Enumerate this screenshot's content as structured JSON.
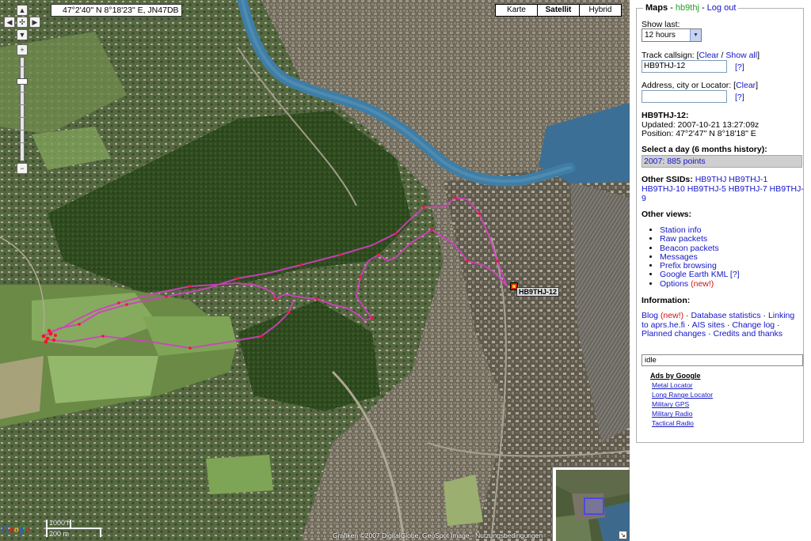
{
  "map": {
    "coordinates": "47°2'40\" N 8°18'23\" E, JN47DB",
    "map_types": [
      {
        "label": "Karte",
        "active": false
      },
      {
        "label": "Satellit",
        "active": true
      },
      {
        "label": "Hybrid",
        "active": false
      }
    ],
    "zoom_in": "+",
    "zoom_out": "−",
    "station_label": "HB9THJ-12",
    "track_color": "#d040c0",
    "beacon_color": "#ff1030",
    "scale": {
      "top": "1000 ft",
      "bottom": "200 m"
    },
    "copyright": "Grafiken ©2007 DigitalGlobe, GeoSpot Image - Nutzungsbedingungen",
    "google_logo": [
      "G",
      "o",
      "o",
      "g",
      "l",
      "e"
    ]
  },
  "sidebar": {
    "legend_title": "Maps",
    "legend_sep1": " - ",
    "user": "hb9thj",
    "legend_sep2": " - ",
    "logout": "Log out",
    "show_last_label": "Show last:",
    "show_last_value": "12 hours",
    "track_label": "Track callsign: [",
    "track_clear": "Clear",
    "track_slash": " / ",
    "track_show_all": "Show all",
    "track_end": "]",
    "track_value": "HB9THJ-12",
    "help": "[?]",
    "address_label": "Address, city or Locator: [",
    "address_clear": "Clear",
    "address_end": "]",
    "address_value": "",
    "station_heading": "HB9THJ-12:",
    "updated": "Updated: 2007-10-21 13:27:09z",
    "position": "Position: 47°2'47\" N 8°18'18\" E",
    "select_day": "Select a day (6 months history):",
    "day_entry": "2007: 885 points",
    "other_ssids_label": "Other SSIDs:",
    "ssids": [
      "HB9THJ",
      "HB9THJ-1",
      "HB9THJ-10",
      "HB9THJ-5",
      "HB9THJ-7",
      "HB9THJ-9"
    ],
    "other_views_label": "Other views:",
    "views": [
      {
        "label": "Station info"
      },
      {
        "label": "Raw packets"
      },
      {
        "label": "Beacon packets"
      },
      {
        "label": "Messages"
      },
      {
        "label": "Prefix browsing"
      },
      {
        "label": "Google Earth KML",
        "suffix": "[?]"
      },
      {
        "label": "Options",
        "new": "(new!)"
      }
    ],
    "information_label": "Information:",
    "info_links": {
      "blog": "Blog",
      "new": "(new!)",
      "sep": " · ",
      "db_stats": "Database statistics",
      "linking": "Linking to aprs.he.fi",
      "ais": "AIS sites",
      "changelog": "Change log",
      "planned": "Planned changes",
      "credits": "Credits and thanks"
    },
    "status_value": "idle",
    "ads_title": "Ads by Google",
    "ads": [
      "Metal Locator",
      "Long Range Locator",
      "Military GPS",
      "Military Radio",
      "Tactical Radio"
    ]
  }
}
